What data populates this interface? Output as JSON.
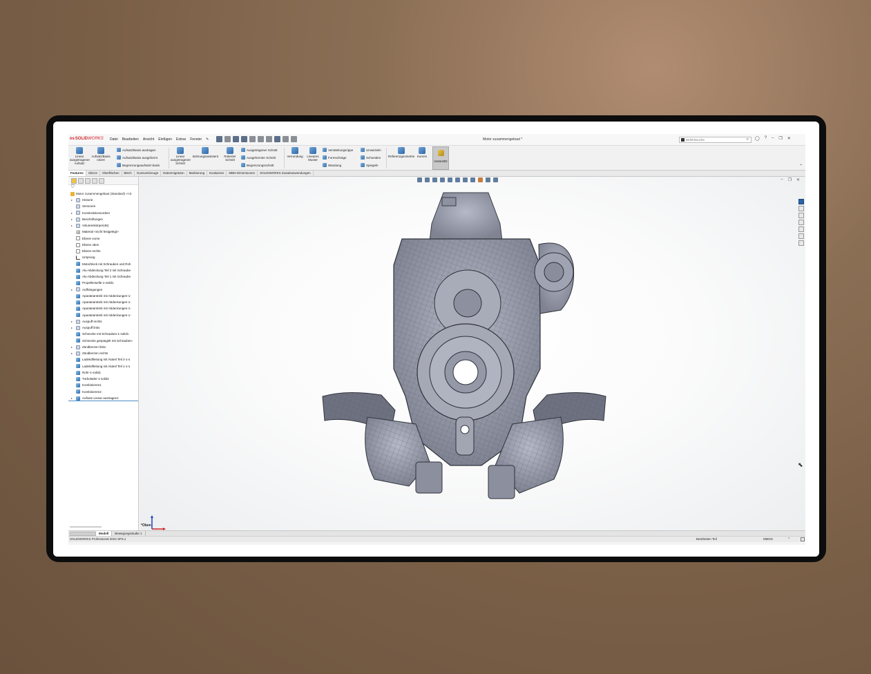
{
  "app": {
    "brand_bold": "SOLID",
    "brand_thin": "WORKS",
    "document_title": "Motor zusammengebaut *",
    "menu": [
      "Datei",
      "Bearbeiten",
      "Ansicht",
      "Einfügen",
      "Extras",
      "Fenster"
    ],
    "search_placeholder": "Befehlssuche"
  },
  "ribbon": {
    "big_buttons": [
      {
        "label": "Linear ausgetragener Aufsatz",
        "icon": "extrude-boss-icon"
      },
      {
        "label": "Aufsatz/Basis rotiert",
        "icon": "revolve-boss-icon"
      },
      {
        "label": "Linear ausgetragener Schnitt",
        "icon": "extrude-cut-icon"
      },
      {
        "label": "Bohrungsassistent",
        "icon": "hole-wizard-icon"
      },
      {
        "label": "Rotierter Schnitt",
        "icon": "revolve-cut-icon"
      },
      {
        "label": "Verrundung",
        "icon": "fillet-icon"
      },
      {
        "label": "Lineares Muster",
        "icon": "linear-pattern-icon"
      },
      {
        "label": "Referenzgeometrie",
        "icon": "reference-geometry-icon"
      },
      {
        "label": "Kurven",
        "icon": "curves-icon"
      },
      {
        "label": "Instant3D",
        "icon": "instant3d-icon"
      }
    ],
    "small_buttons": [
      "Aufsatz/Basis austragen",
      "Aufsatz/Basis ausgeformt",
      "Begrenzungsaufsatz/-basis",
      "Ausgetragener Schnitt",
      "Ausgeformter Schnitt",
      "Begrenzungsschnitt",
      "Verstärkungsrippe",
      "Formschräge",
      "Wandung",
      "Umwickeln",
      "Schneiden",
      "Spiegeln"
    ]
  },
  "command_tabs": [
    "Features",
    "Skizze",
    "Oberflächen",
    "Blech",
    "Gussverkzeuge",
    "Datenmigration",
    "Markierung",
    "Evaluieren",
    "MBD-Dimensionen",
    "SOLIDWORKS Zusatzanwendungen"
  ],
  "feature_tree": {
    "root": "Motor zusammengebaut (Standard) <<S",
    "items": [
      {
        "label": "Historie",
        "icon": "folder",
        "toggle": "▸"
      },
      {
        "label": "Sensoren",
        "icon": "folder",
        "toggle": ""
      },
      {
        "label": "Konstruktionsordner",
        "icon": "folder",
        "toggle": "▸"
      },
      {
        "label": "Beschriftungen",
        "icon": "folder",
        "toggle": "▸"
      },
      {
        "label": "Volumenkörper(46)",
        "icon": "folder",
        "toggle": "▸"
      },
      {
        "label": "Material <nicht festgelegt>",
        "icon": "mat",
        "toggle": ""
      },
      {
        "label": "Ebene vorne",
        "icon": "plane",
        "toggle": ""
      },
      {
        "label": "Ebene oben",
        "icon": "plane",
        "toggle": ""
      },
      {
        "label": "Ebene rechts",
        "icon": "plane",
        "toggle": ""
      },
      {
        "label": "Ursprung",
        "icon": "origin",
        "toggle": ""
      },
      {
        "label": "Motorblock mit Schrauben und Roh",
        "icon": "body",
        "toggle": ""
      },
      {
        "label": "Alu-Abdeckung Teil 2 mit Schraube",
        "icon": "body",
        "toggle": ""
      },
      {
        "label": "Alu-Abdeckung Teil 1 mit Schraube",
        "icon": "body",
        "toggle": ""
      },
      {
        "label": "Propellerwelle-1-solid1",
        "icon": "body",
        "toggle": ""
      },
      {
        "label": "Aufhängungen",
        "icon": "folder",
        "toggle": "▸"
      },
      {
        "label": "Aparateantrieb mit Abdeckungen-1-",
        "icon": "body",
        "toggle": ""
      },
      {
        "label": "Aparateantrieb mit Abdeckungen-1-",
        "icon": "body",
        "toggle": ""
      },
      {
        "label": "Aparateantrieb mit Abdeckungen-1-",
        "icon": "body",
        "toggle": ""
      },
      {
        "label": "Aparateantrieb mit Abdeckungen-1-",
        "icon": "body",
        "toggle": ""
      },
      {
        "label": "Auspuff rechts",
        "icon": "folder",
        "toggle": "▸"
      },
      {
        "label": "Auspuff links",
        "icon": "folder",
        "toggle": "▸"
      },
      {
        "label": "Schnecke mit Schrauben-1-solid1",
        "icon": "body",
        "toggle": ""
      },
      {
        "label": "Schnecke gespiegelt mit Schrauben-",
        "icon": "body",
        "toggle": ""
      },
      {
        "label": "Zündkerzen links",
        "icon": "folder",
        "toggle": "▸"
      },
      {
        "label": "Zündkerzen rechts",
        "icon": "folder",
        "toggle": "▸"
      },
      {
        "label": "Ladeluftleitung mit Aluteil Teil 2-1-s",
        "icon": "body",
        "toggle": ""
      },
      {
        "label": "Ladeluftleitung mit Aluteil Teil 1-1-s",
        "icon": "body",
        "toggle": ""
      },
      {
        "label": "Rohr-1-solid1",
        "icon": "body",
        "toggle": ""
      },
      {
        "label": "Turbolader-1-solid1",
        "icon": "body",
        "toggle": ""
      },
      {
        "label": "Kombinieren1",
        "icon": "body",
        "toggle": ""
      },
      {
        "label": "Kombinieren2",
        "icon": "body",
        "toggle": ""
      },
      {
        "label": "Aufsatz-Linear austragen1",
        "icon": "body",
        "toggle": "▸"
      }
    ]
  },
  "viewport": {
    "view_orientation": "*Oben"
  },
  "model_tabs": [
    "Modell",
    "Bewegungsstudie 1"
  ],
  "status": {
    "product": "SOLIDWORKS Professional 2024 SP3.1",
    "mode": "Bearbeiten Teil",
    "units": "MMGS"
  }
}
